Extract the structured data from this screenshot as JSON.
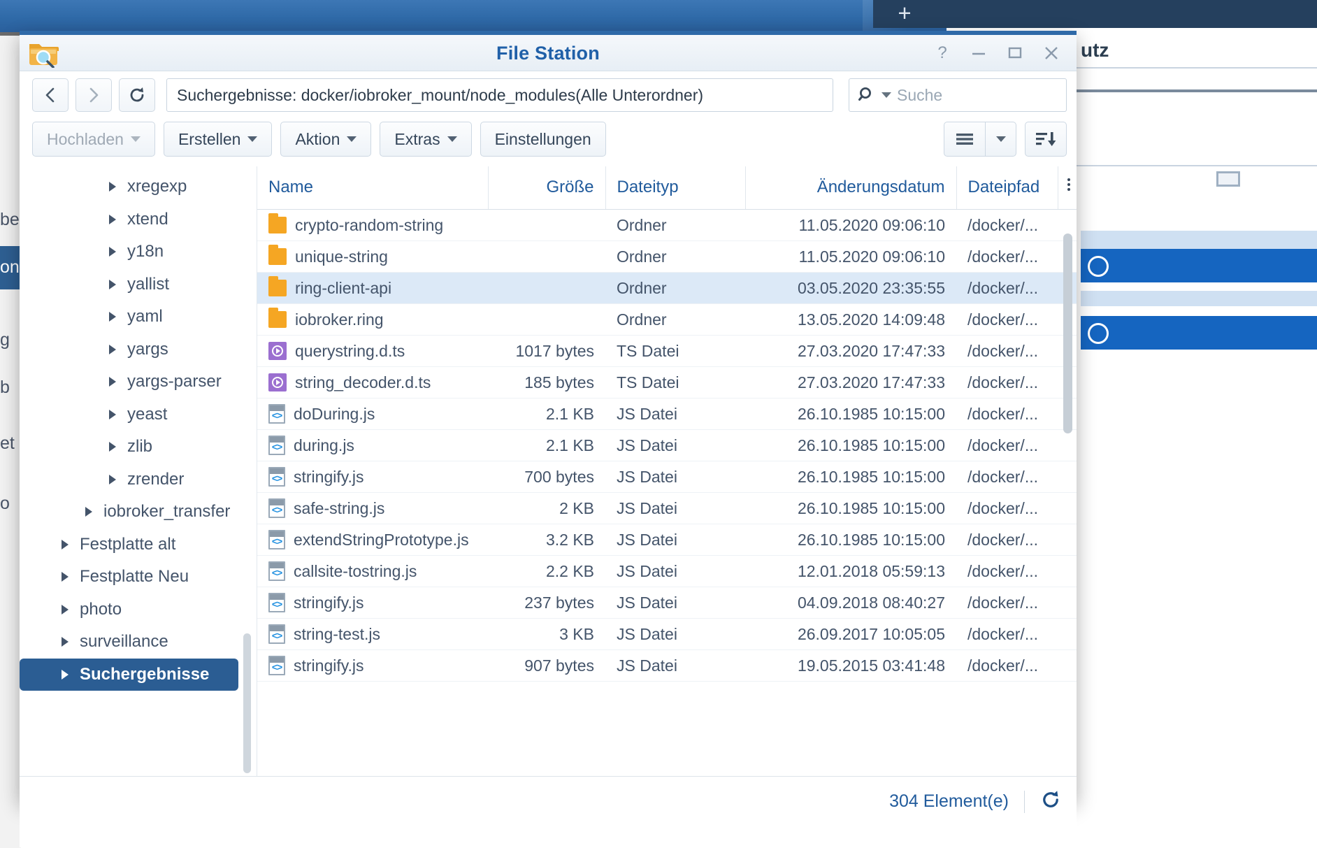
{
  "background": {
    "new_tab_icon": "plus-icon",
    "right_panel_title": "utz",
    "left_fragments": [
      "be",
      "on",
      "g",
      "b",
      "et",
      "o"
    ]
  },
  "window": {
    "title": "File Station",
    "app_icon": "folder-search-icon",
    "controls": {
      "help": "help-icon",
      "minimize": "minimize-icon",
      "maximize": "maximize-icon",
      "close": "close-icon"
    }
  },
  "navbar": {
    "back_icon": "chevron-left-icon",
    "forward_icon": "chevron-right-icon",
    "refresh_icon": "refresh-icon",
    "path": "Suchergebnisse: docker/iobroker_mount/node_modules(Alle Unterordner)",
    "search_icon": "search-icon",
    "search_placeholder": "Suche"
  },
  "toolbar": {
    "buttons": [
      {
        "label": "Hochladen",
        "has_caret": true,
        "disabled": true
      },
      {
        "label": "Erstellen",
        "has_caret": true,
        "disabled": false
      },
      {
        "label": "Aktion",
        "has_caret": true,
        "disabled": false
      },
      {
        "label": "Extras",
        "has_caret": true,
        "disabled": false
      },
      {
        "label": "Einstellungen",
        "has_caret": false,
        "disabled": false
      }
    ],
    "view_mode_icon": "list-view-icon",
    "view_mode_caret_icon": "chevron-down-icon",
    "sort_icon": "sort-descending-icon"
  },
  "sidebar": {
    "items": [
      {
        "label": "xregexp",
        "indent": 3,
        "selected": false
      },
      {
        "label": "xtend",
        "indent": 3,
        "selected": false
      },
      {
        "label": "y18n",
        "indent": 3,
        "selected": false
      },
      {
        "label": "yallist",
        "indent": 3,
        "selected": false
      },
      {
        "label": "yaml",
        "indent": 3,
        "selected": false
      },
      {
        "label": "yargs",
        "indent": 3,
        "selected": false
      },
      {
        "label": "yargs-parser",
        "indent": 3,
        "selected": false
      },
      {
        "label": "yeast",
        "indent": 3,
        "selected": false
      },
      {
        "label": "zlib",
        "indent": 3,
        "selected": false
      },
      {
        "label": "zrender",
        "indent": 3,
        "selected": false
      },
      {
        "label": "iobroker_transfer",
        "indent": 2,
        "selected": false
      },
      {
        "label": "Festplatte alt",
        "indent": 1,
        "selected": false
      },
      {
        "label": "Festplatte Neu",
        "indent": 1,
        "selected": false
      },
      {
        "label": "photo",
        "indent": 1,
        "selected": false
      },
      {
        "label": "surveillance",
        "indent": 1,
        "selected": false
      },
      {
        "label": "Suchergebnisse",
        "indent": 1,
        "selected": true
      }
    ]
  },
  "filelist": {
    "columns": [
      {
        "key": "name",
        "label": "Name",
        "align": "left"
      },
      {
        "key": "size",
        "label": "Größe",
        "align": "right"
      },
      {
        "key": "type",
        "label": "Dateityp",
        "align": "left"
      },
      {
        "key": "modified",
        "label": "Änderungsdatum",
        "align": "right"
      },
      {
        "key": "path",
        "label": "Dateipfad",
        "align": "left"
      }
    ],
    "column_options_icon": "kebab-menu-icon",
    "rows": [
      {
        "icon": "folder-icon",
        "name": "crypto-random-string",
        "size": "",
        "type": "Ordner",
        "modified": "11.05.2020 09:06:10",
        "path": "/docker/...",
        "selected": false
      },
      {
        "icon": "folder-icon",
        "name": "unique-string",
        "size": "",
        "type": "Ordner",
        "modified": "11.05.2020 09:06:10",
        "path": "/docker/...",
        "selected": false
      },
      {
        "icon": "folder-icon",
        "name": "ring-client-api",
        "size": "",
        "type": "Ordner",
        "modified": "03.05.2020 23:35:55",
        "path": "/docker/...",
        "selected": true
      },
      {
        "icon": "folder-icon",
        "name": "iobroker.ring",
        "size": "",
        "type": "Ordner",
        "modified": "13.05.2020 14:09:48",
        "path": "/docker/...",
        "selected": false
      },
      {
        "icon": "ts-file-icon",
        "name": "querystring.d.ts",
        "size": "1017 bytes",
        "type": "TS Datei",
        "modified": "27.03.2020 17:47:33",
        "path": "/docker/...",
        "selected": false
      },
      {
        "icon": "ts-file-icon",
        "name": "string_decoder.d.ts",
        "size": "185 bytes",
        "type": "TS Datei",
        "modified": "27.03.2020 17:47:33",
        "path": "/docker/...",
        "selected": false
      },
      {
        "icon": "js-file-icon",
        "name": "doDuring.js",
        "size": "2.1 KB",
        "type": "JS Datei",
        "modified": "26.10.1985 10:15:00",
        "path": "/docker/...",
        "selected": false
      },
      {
        "icon": "js-file-icon",
        "name": "during.js",
        "size": "2.1 KB",
        "type": "JS Datei",
        "modified": "26.10.1985 10:15:00",
        "path": "/docker/...",
        "selected": false
      },
      {
        "icon": "js-file-icon",
        "name": "stringify.js",
        "size": "700 bytes",
        "type": "JS Datei",
        "modified": "26.10.1985 10:15:00",
        "path": "/docker/...",
        "selected": false
      },
      {
        "icon": "js-file-icon",
        "name": "safe-string.js",
        "size": "2 KB",
        "type": "JS Datei",
        "modified": "26.10.1985 10:15:00",
        "path": "/docker/...",
        "selected": false
      },
      {
        "icon": "js-file-icon",
        "name": "extendStringPrototype.js",
        "size": "3.2 KB",
        "type": "JS Datei",
        "modified": "26.10.1985 10:15:00",
        "path": "/docker/...",
        "selected": false
      },
      {
        "icon": "js-file-icon",
        "name": "callsite-tostring.js",
        "size": "2.2 KB",
        "type": "JS Datei",
        "modified": "12.01.2018 05:59:13",
        "path": "/docker/...",
        "selected": false
      },
      {
        "icon": "js-file-icon",
        "name": "stringify.js",
        "size": "237 bytes",
        "type": "JS Datei",
        "modified": "04.09.2018 08:40:27",
        "path": "/docker/...",
        "selected": false
      },
      {
        "icon": "js-file-icon",
        "name": "string-test.js",
        "size": "3 KB",
        "type": "JS Datei",
        "modified": "26.09.2017 10:05:05",
        "path": "/docker/...",
        "selected": false
      },
      {
        "icon": "js-file-icon",
        "name": "stringify.js",
        "size": "907 bytes",
        "type": "JS Datei",
        "modified": "19.05.2015 03:41:48",
        "path": "/docker/...",
        "selected": false
      }
    ]
  },
  "statusbar": {
    "count_label": "304 Element(e)",
    "refresh_icon": "refresh-icon"
  },
  "colors": {
    "accent": "#2060a8",
    "selection": "#dce9f7",
    "sidebar_selection": "#2b5d93",
    "folder": "#f5a623",
    "ts_file": "#9b6fd0",
    "js_file": "#1f8fe0"
  }
}
